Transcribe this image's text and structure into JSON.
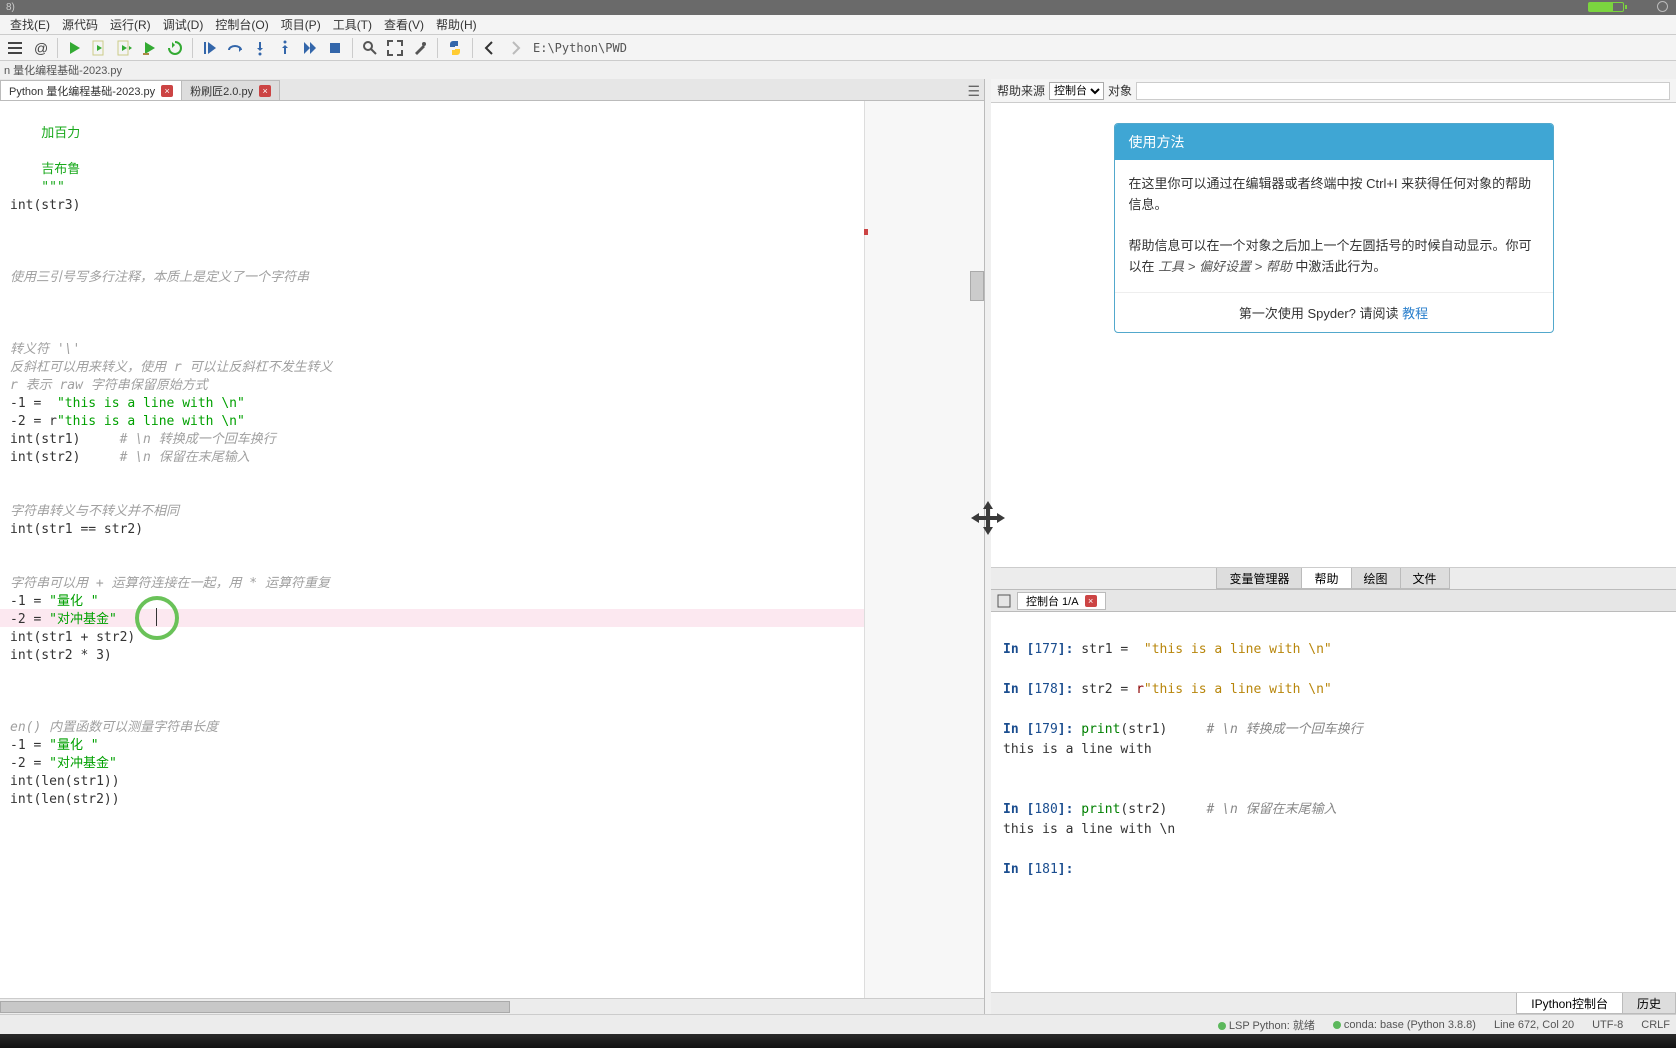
{
  "version": "8)",
  "menu": {
    "edit": "查找(E)",
    "source": "源代码",
    "run": "运行(R)",
    "debug": "调试(D)",
    "console": "控制台(O)",
    "project": "项目(P)",
    "tools": "工具(T)",
    "view": "查看(V)",
    "help": "帮助(H)"
  },
  "toolbar": {
    "path": "E:\\Python\\PWD"
  },
  "breadcrumb": {
    "text": "n 量化编程基础-2023.py"
  },
  "tabs": {
    "tab1": "Python 量化编程基础-2023.py",
    "tab2": "粉刷匠2.0.py"
  },
  "code": {
    "l1": "    加百力",
    "l2": "",
    "l3": "    吉布鲁",
    "l4": "    \"\"\"",
    "l5": "int(str3)",
    "l6": "",
    "l7": "",
    "l8": "",
    "l9": "使用三引号写多行注释，本质上是定义了一个字符串",
    "l10": "",
    "l11": "",
    "l12": "",
    "l13": "转义符 '\\'",
    "l14": "反斜杠可以用来转义，使用 r 可以让反斜杠不发生转义",
    "l15": "r 表示 raw 字符串保留原始方式",
    "l16_a": "-1 =  ",
    "l16_b": "\"this is a line with \\n\"",
    "l17_a": "-2 = r",
    "l17_b": "\"this is a line with \\n\"",
    "l18_a": "int(str1)     ",
    "l18_b": "# \\n 转换成一个回车换行",
    "l19_a": "int(str2)     ",
    "l19_b": "# \\n 保留在末尾输入",
    "l20": "",
    "l21": "",
    "l22": "字符串转义与不转义并不相同",
    "l23": "int(str1 == str2)",
    "l24": "",
    "l25": "",
    "l26": "字符串可以用 + 运算符连接在一起，用 * 运算符重复",
    "l27_a": "-1 = ",
    "l27_b": "\"量化 \"",
    "l28_a": "-2 = ",
    "l28_b": "\"对冲基金\"",
    "l29": "int(str1 + str2)",
    "l30": "int(str2 * 3)",
    "l31": "",
    "l32": "",
    "l33": "",
    "l34": "en() 内置函数可以测量字符串长度",
    "l35_a": "-1 = ",
    "l35_b": "\"量化 \"",
    "l36_a": "-2 = ",
    "l36_b": "\"对冲基金\"",
    "l37": "int(len(str1))",
    "l38": "int(len(str2))"
  },
  "help": {
    "src_label": "帮助来源",
    "src_option": "控制台",
    "obj_label": "对象",
    "title": "使用方法",
    "body1": "在这里你可以通过在编辑器或者终端中按 Ctrl+I 来获得任何对象的帮助信息。",
    "body2a": "帮助信息可以在一个对象之后加上一个左圆括号的时候自动显示。你可以在",
    "body2b": "工具 > 偏好设置 > 帮助",
    "body2c": " 中激活此行为。",
    "foot1": "第一次使用 Spyder? 请阅读 ",
    "foot_link": "教程",
    "tabs": {
      "var": "变量管理器",
      "help": "帮助",
      "plot": "绘图",
      "file": "文件"
    }
  },
  "console": {
    "tab": "控制台 1/A",
    "in177": "In [",
    "n177": "177",
    "in177b": "]: ",
    "l177_a": "str1 =  ",
    "l177_b": "\"this is a line with \\n\"",
    "in178": "In [",
    "n178": "178",
    "in178b": "]: ",
    "l178_a": "str2 = ",
    "l178_r": "r",
    "l178_b": "\"this is a line with \\n\"",
    "in179": "In [",
    "n179": "179",
    "in179b": "]: ",
    "l179_a": "print",
    "l179_b": "(str1)     ",
    "l179_c": "# \\n 转换成一个回车换行",
    "out179": "this is a line with ",
    "in180": "In [",
    "n180": "180",
    "in180b": "]: ",
    "l180_a": "print",
    "l180_b": "(str2)     ",
    "l180_c": "# \\n 保留在末尾输入",
    "out180": "this is a line with \\n",
    "in181": "In [",
    "n181": "181",
    "in181b": "]: "
  },
  "bottom_tabs": {
    "ipy": "IPython控制台",
    "hist": "历史"
  },
  "status": {
    "lsp": "LSP Python: 就绪",
    "conda": "conda: base (Python 3.8.8)",
    "pos": "Line 672, Col 20",
    "enc": "UTF-8",
    "eol": "CRLF"
  }
}
